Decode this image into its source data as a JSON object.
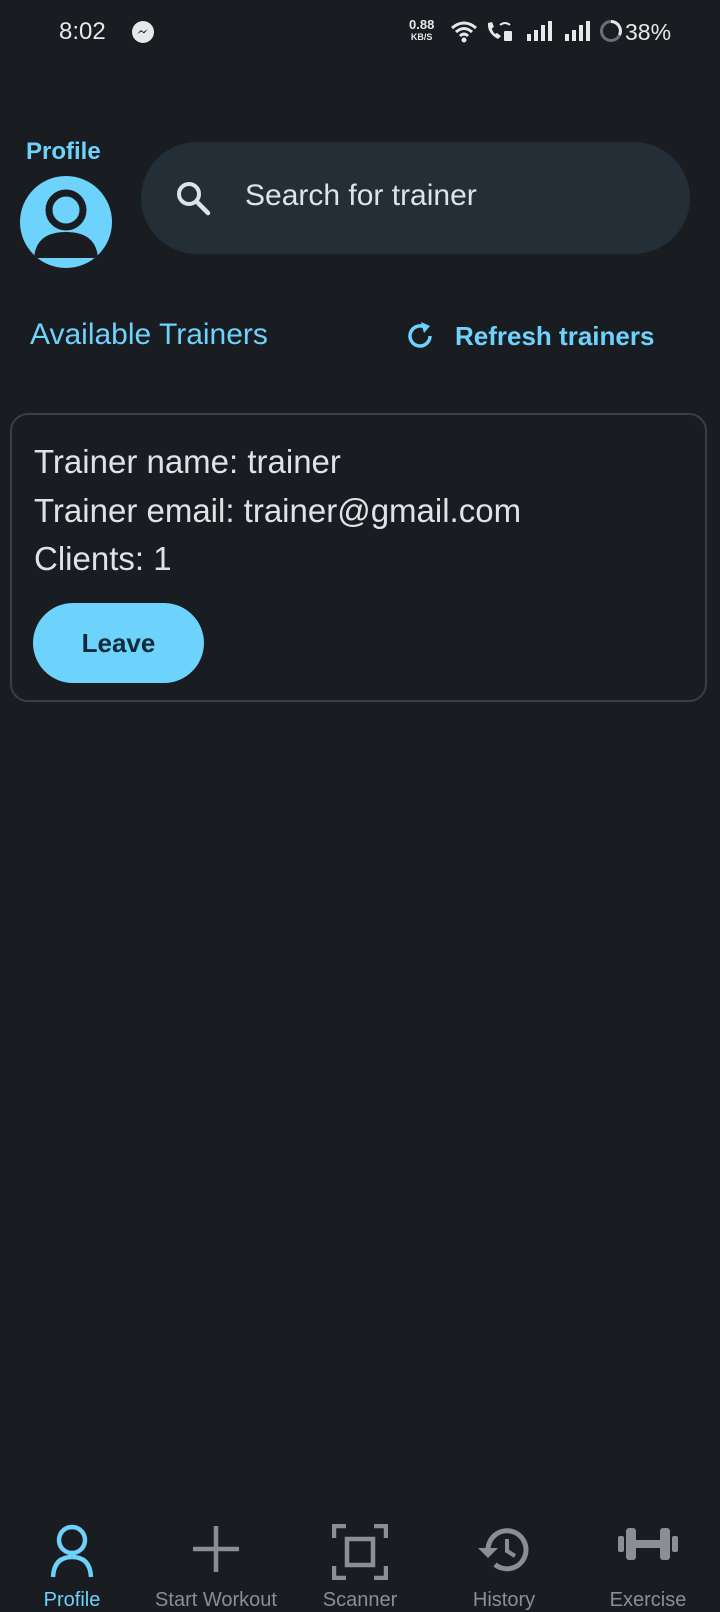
{
  "status_bar": {
    "time": "8:02",
    "net_speed_value": "0.88",
    "net_speed_unit": "KB/S",
    "battery": "38%",
    "icons": [
      "messenger-icon",
      "wifi-icon",
      "wifi-calling-icon",
      "signal-icon",
      "signal-icon",
      "battery-icon"
    ]
  },
  "header": {
    "profile_label": "Profile",
    "search_placeholder": "Search for trainer"
  },
  "section": {
    "title": "Available Trainers",
    "refresh_label": "Refresh trainers"
  },
  "trainer_card": {
    "name_line": "Trainer name: trainer",
    "email_line": "Trainer email: trainer@gmail.com",
    "clients_line": "Clients: 1",
    "leave_label": "Leave"
  },
  "bottom_nav": {
    "items": [
      {
        "label": "Profile",
        "icon": "person-icon",
        "active": true
      },
      {
        "label": "Start Workout",
        "icon": "plus-icon",
        "active": false
      },
      {
        "label": "Scanner",
        "icon": "scanner-icon",
        "active": false
      },
      {
        "label": "History",
        "icon": "history-icon",
        "active": false
      },
      {
        "label": "Exercise",
        "icon": "dumbbell-icon",
        "active": false
      }
    ]
  },
  "colors": {
    "background": "#191c20",
    "accent": "#6dd3fc",
    "search_background": "#232e36",
    "inactive_nav": "#8b8e93"
  }
}
